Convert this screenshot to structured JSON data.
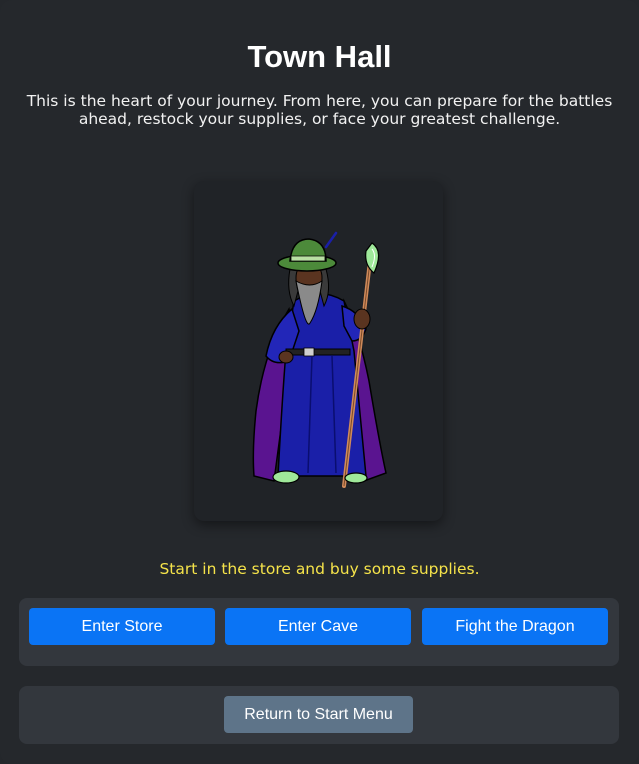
{
  "page": {
    "title": "Town Hall",
    "intro": "This is the heart of your journey. From here, you can prepare for the battles ahead, restock your supplies, or face your greatest challenge."
  },
  "portrait": {
    "icon": "wizard-icon",
    "colors": {
      "robe": "#1a1fa8",
      "cloak": "#5a1490",
      "hat": "#4c8a3a",
      "staff": "#d08a5a",
      "staff_gem": "#9fe89a"
    }
  },
  "message": {
    "text": "Start in the store and buy some supplies.",
    "color": "#f5e34a"
  },
  "actions": {
    "store_label": "Enter Store",
    "cave_label": "Enter Cave",
    "dragon_label": "Fight the Dragon",
    "color": "#0a74f5"
  },
  "menu": {
    "return_label": "Return to Start Menu",
    "color": "#5e7489"
  }
}
